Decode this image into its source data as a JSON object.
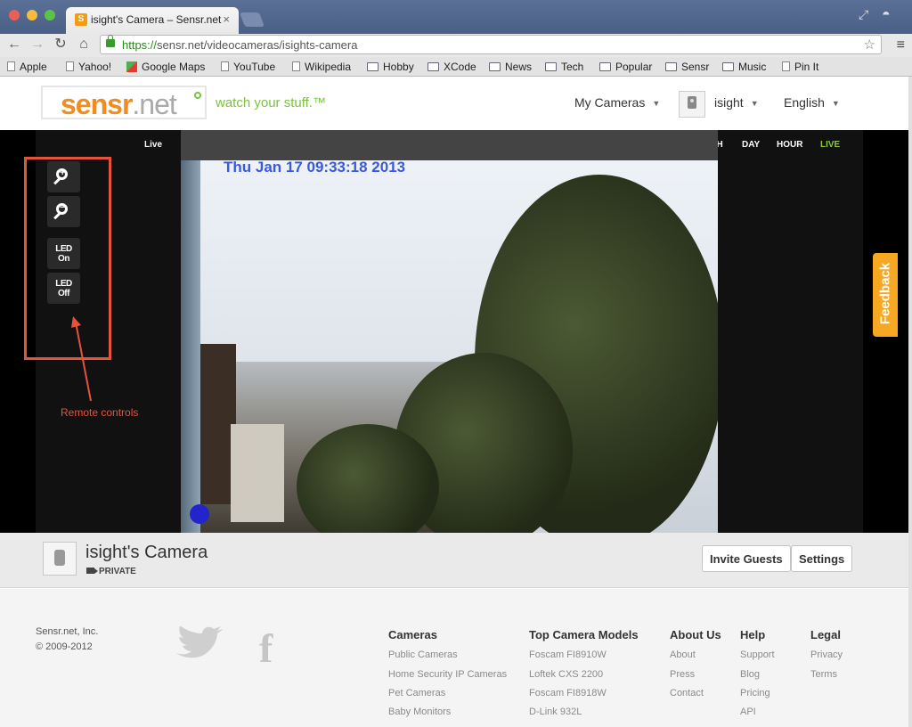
{
  "browser": {
    "tab_title": "isight's Camera – Sensr.net",
    "tab_favicon": "S",
    "url_scheme": "https://",
    "url_rest": "sensr.net/videocameras/isights-camera",
    "bookmarks": [
      "Apple",
      "Yahoo!",
      "Google Maps",
      "YouTube",
      "Wikipedia",
      "Hobby",
      "XCode",
      "News",
      "Tech",
      "Popular",
      "Sensr",
      "Music",
      "Pin It"
    ]
  },
  "header": {
    "logo_main": "sensr",
    "logo_suffix": ".net",
    "tagline": "watch your stuff.™",
    "my_cameras": "My Cameras",
    "username": "isight",
    "language": "English"
  },
  "viewer": {
    "live_label": "Live",
    "ranges": [
      "MONTH",
      "DAY",
      "HOUR",
      "LIVE"
    ],
    "timestamp": "Thu Jan 17 09:33:18 2013",
    "controls": {
      "led_on_1": "LED",
      "led_on_2": "On",
      "led_off_1": "LED",
      "led_off_2": "Off"
    },
    "annotation": "Remote controls",
    "feedback": "Feedback"
  },
  "camera": {
    "name": "isight's Camera",
    "visibility": "PRIVATE",
    "invite": "Invite Guests",
    "settings": "Settings"
  },
  "footer": {
    "company": "Sensr.net, Inc.",
    "copyright": "© 2009-2012",
    "columns": [
      {
        "title": "Cameras",
        "links": [
          "Public Cameras",
          "Home Security IP Cameras",
          "Pet Cameras",
          "Baby Monitors"
        ]
      },
      {
        "title": "Top Camera Models",
        "links": [
          "Foscam FI8910W",
          "Loftek CXS 2200",
          "Foscam FI8918W",
          "D-Link 932L"
        ]
      },
      {
        "title": "About Us",
        "links": [
          "About",
          "Press",
          "Contact"
        ]
      },
      {
        "title": "Help",
        "links": [
          "Support",
          "Blog",
          "Pricing",
          "API"
        ]
      },
      {
        "title": "Legal",
        "links": [
          "Privacy",
          "Terms"
        ]
      }
    ]
  },
  "colors": {
    "brand_orange": "#f28c1f",
    "brand_green": "#7cc142",
    "live_green": "#8dc63f",
    "annotation_red": "#e5533d",
    "feedback_orange": "#f7a823"
  }
}
